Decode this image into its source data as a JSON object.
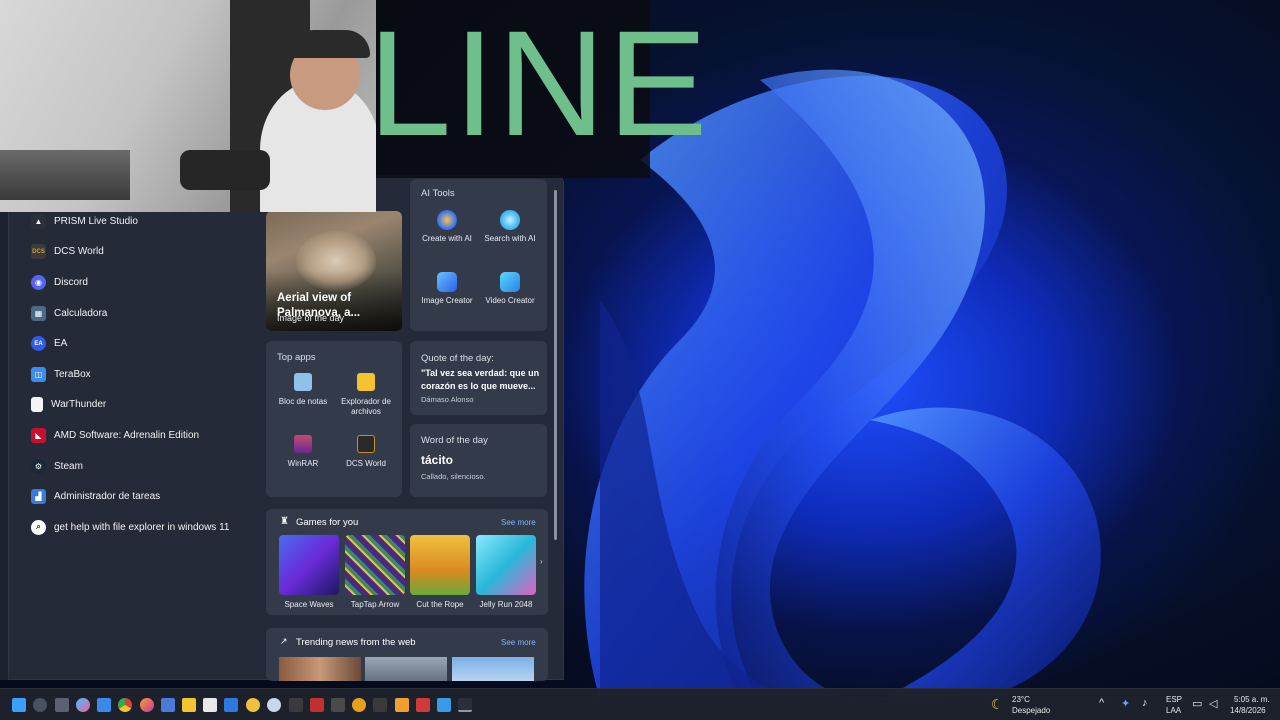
{
  "banner": {
    "text": "LINE"
  },
  "start_menu": {
    "apps": [
      {
        "label": "PRISM Live Studio",
        "icon": "prism-icon",
        "color": "#2a2f3a"
      },
      {
        "label": "DCS World",
        "icon": "dcs-icon",
        "color": "#3a3a3a"
      },
      {
        "label": "Discord",
        "icon": "discord-icon",
        "color": "#5865f2"
      },
      {
        "label": "Calculadora",
        "icon": "calculator-icon",
        "color": "#4a6a8a"
      },
      {
        "label": "EA",
        "icon": "ea-icon",
        "color": "#2f5bea"
      },
      {
        "label": "TeraBox",
        "icon": "terabox-icon",
        "color": "#3c8df0"
      },
      {
        "label": "WarThunder",
        "icon": "file-icon",
        "color": "#f4f4f4"
      },
      {
        "label": "AMD Software: Adrenalin Edition",
        "icon": "amd-icon",
        "color": "#c8102e"
      },
      {
        "label": "Steam",
        "icon": "steam-icon",
        "color": "#1b2838"
      },
      {
        "label": "Administrador de tareas",
        "icon": "task-manager-icon",
        "color": "#3a7bd5"
      },
      {
        "label": "get help with file explorer in windows 11",
        "icon": "search-icon",
        "color": "#ffffff"
      }
    ],
    "photo": {
      "tag": "Image of the day",
      "caption": "Aerial view of Palmanova, a..."
    },
    "ai_tools": {
      "title": "AI Tools",
      "items": [
        {
          "label": "Create with AI",
          "color": "#f0a040"
        },
        {
          "label": "Search with AI",
          "color": "#40b8f0"
        },
        {
          "label": "Image Creator",
          "color": "#3a8ef0"
        },
        {
          "label": "Video Creator",
          "color": "#2aa8e8"
        }
      ]
    },
    "top_apps": {
      "title": "Top apps",
      "items": [
        {
          "label": "Bloc de notas",
          "color": "#8fc1ea"
        },
        {
          "label": "Explorador de archivos",
          "color": "#f4c430"
        },
        {
          "label": "WinRAR",
          "color": "#9b3a6a"
        },
        {
          "label": "DCS World",
          "color": "#3a3a3a"
        }
      ]
    },
    "quote": {
      "title": "Quote of the day:",
      "text": "\"Tal vez sea verdad: que un corazón es lo que mueve...",
      "author": "Dámaso Alonso"
    },
    "word": {
      "title": "Word of the day",
      "word": "tácito",
      "definition": "Callado, silencioso."
    },
    "games": {
      "title": "Games for you",
      "see_more": "See more",
      "items": [
        {
          "label": "Space Waves",
          "color": "#3b4ed8"
        },
        {
          "label": "TapTap Arrow",
          "color": "#7a3da8"
        },
        {
          "label": "Cut the Rope",
          "color": "#e8a020"
        },
        {
          "label": "Jelly Run 2048",
          "color": "#28b8d8"
        }
      ]
    },
    "news": {
      "title": "Trending news from the web",
      "see_more": "See more"
    }
  },
  "taskbar": {
    "weather_temp": "23°C",
    "weather_desc": "Despejado",
    "lang_top": "ESP",
    "lang_bottom": "LAA",
    "time": "5:05 a. m.",
    "date": "14/8/2026"
  }
}
